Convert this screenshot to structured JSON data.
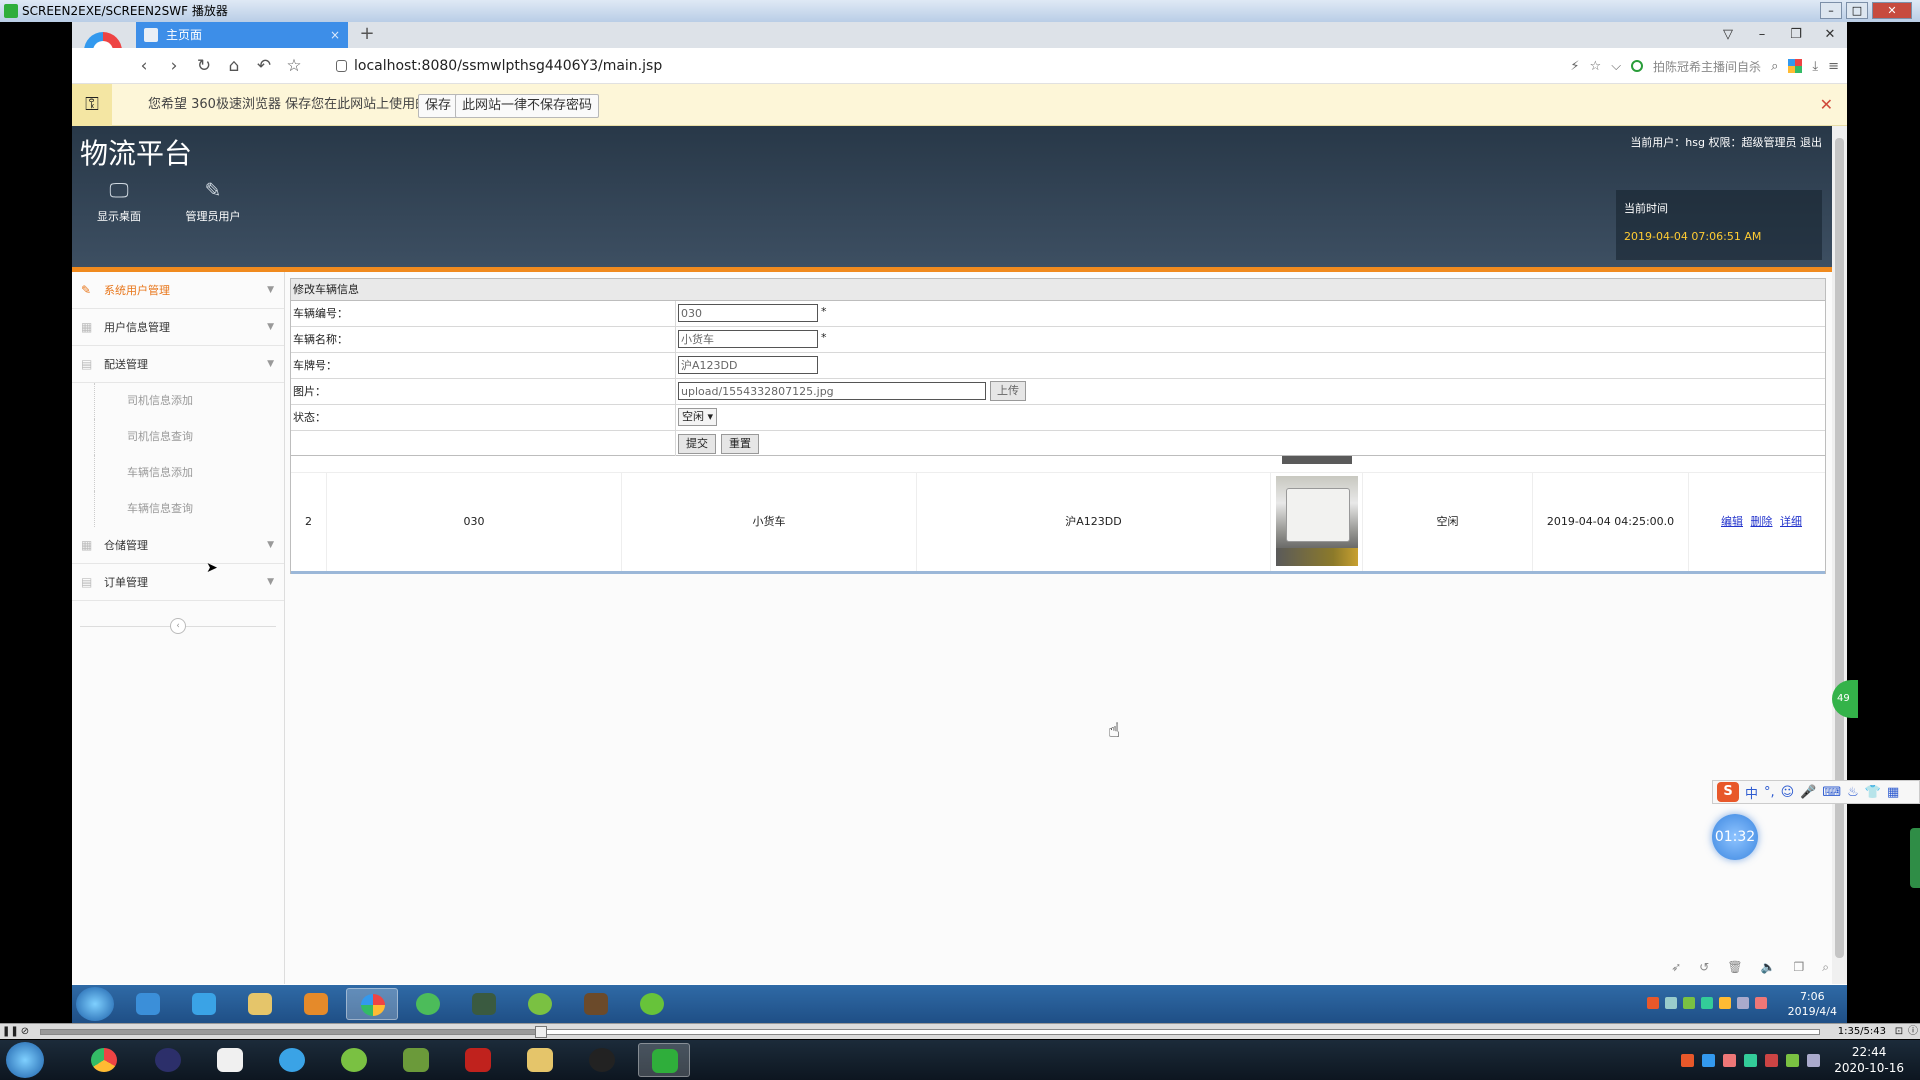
{
  "player": {
    "title": "SCREEN2EXE/SCREEN2SWF 播放器",
    "min": "–",
    "max": "□",
    "close": "✕",
    "elapsed": "1:35/5:43"
  },
  "browser": {
    "tab_title": "主页面",
    "tab_close": "×",
    "new_tab": "+",
    "url": "localhost:8080/ssmwlpthsg4406Y3/main.jsp",
    "search_hint": "拍陈冠希主播间自杀",
    "nav": {
      "back": "‹",
      "forward": "›",
      "reload": "↻",
      "home": "⌂",
      "undo": "↶",
      "star": "☆"
    },
    "win_controls": [
      "▽",
      "–",
      "❐",
      "✕"
    ],
    "addr_icons": [
      "⚡",
      "☆",
      "⌵"
    ],
    "addr_right_icons": [
      "⌕",
      "⤓",
      "≡"
    ]
  },
  "pwdbar": {
    "message": "您希望 360极速浏览器 保存您在此网站上使用的帐号吗？",
    "save": "保存",
    "never": "此网站一律不保存密码",
    "close": "✕"
  },
  "header": {
    "brand": "物流平台",
    "user_info": "当前用户：hsg 权限：超级管理员 退出",
    "nav": [
      {
        "label": "显示桌面",
        "icon": "monitor-icon",
        "glyph": "🖵"
      },
      {
        "label": "管理员用户",
        "icon": "pencil-icon",
        "glyph": "✎"
      }
    ],
    "clock_label": "当前时间",
    "clock_time": "2019-04-04 07:06:51 AM"
  },
  "sidebar": {
    "items": [
      {
        "label": "系统用户管理",
        "active": true,
        "icon": "✎"
      },
      {
        "label": "用户信息管理",
        "active": false,
        "icon": "▦"
      },
      {
        "label": "配送管理",
        "active": false,
        "icon": "▤"
      }
    ],
    "sub_items": [
      "司机信息添加",
      "司机信息查询",
      "车辆信息添加",
      "车辆信息查询"
    ],
    "items2": [
      {
        "label": "仓储管理",
        "icon": "▦"
      },
      {
        "label": "订单管理",
        "icon": "▤"
      }
    ],
    "collapse": "‹",
    "arrow": "▼"
  },
  "form": {
    "title": "修改车辆信息",
    "fields": [
      {
        "label": "车辆编号：",
        "value": "030",
        "required": "*"
      },
      {
        "label": "车辆名称：",
        "value": "小货车",
        "required": "*"
      },
      {
        "label": "车牌号：",
        "value": "沪A123DD"
      },
      {
        "label": "图片：",
        "value": "upload/1554332807125.jpg",
        "button": "上传"
      },
      {
        "label": "状态：",
        "value": "空闲 ▾"
      }
    ],
    "submit": "提交",
    "reset": "重置"
  },
  "table": {
    "row": {
      "index": "2",
      "code": "030",
      "name": "小货车",
      "plate": "沪A123DD",
      "status": "空闲",
      "time": "2019-04-04 04:25:00.0"
    },
    "ops": [
      "编辑",
      "删除",
      "详细"
    ]
  },
  "inner_taskbar": {
    "time": "7:06",
    "date": "2019/4/4"
  },
  "host_taskbar": {
    "time": "22:44",
    "date": "2020-10-16"
  },
  "ime": {
    "label": "S",
    "chars": [
      "中",
      "°,",
      "☺",
      "🎤",
      "⌨",
      "♨",
      "👕",
      "▦"
    ]
  },
  "timer": "01:32",
  "bubble": "49",
  "colors": {
    "accent_orange": "#f08a1e",
    "header_bg": "#2f4053",
    "clock_time": "#ffcc33",
    "tab_blue": "#3d8ee8",
    "link": "#2233cc"
  }
}
